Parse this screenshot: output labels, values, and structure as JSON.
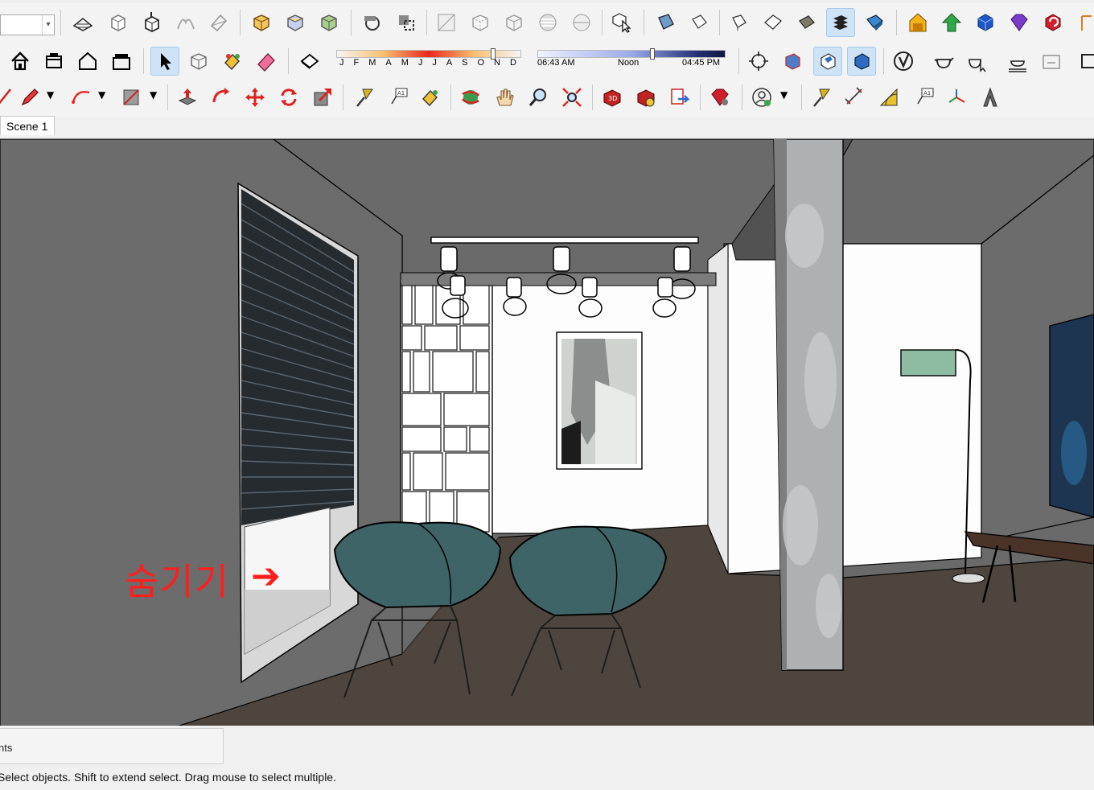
{
  "toolbar": {
    "combo_value": "",
    "months": [
      "J",
      "F",
      "M",
      "A",
      "M",
      "J",
      "J",
      "A",
      "S",
      "O",
      "N",
      "D"
    ],
    "time_start": "06:43 AM",
    "time_noon": "Noon",
    "time_end": "04:45 PM"
  },
  "scene_tab": {
    "label": "Scene 1"
  },
  "viewport": {
    "annotation_text": "숨기기",
    "annotation_arrow": "➔"
  },
  "status": {
    "measurements_label": "nts",
    "message": "Select objects. Shift to extend select. Drag mouse to select multiple."
  },
  "colors": {
    "wall": "#6c6c6c",
    "floor": "#4e463e",
    "chair": "#3f6468",
    "annotation": "#ff1e1e",
    "toolbar_bg": "#f3f3f3"
  }
}
